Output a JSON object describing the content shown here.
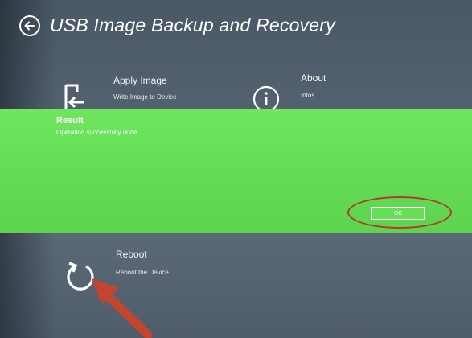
{
  "app": {
    "title": "USB Image Backup and Recovery"
  },
  "tiles": [
    {
      "title": "Apply Image",
      "subtitle": "Write Image to Device",
      "icon": "import-arrow-icon"
    },
    {
      "title": "About",
      "subtitle": "Infos",
      "icon": "info-icon"
    },
    {
      "title": "Reboot",
      "subtitle": "Reboot the Device",
      "icon": "refresh-icon"
    }
  ],
  "dialog": {
    "title": "Result",
    "message": "Operation successfully done.",
    "ok_label": "OK",
    "background_color": "#66de56"
  },
  "colors": {
    "background": "#556372",
    "annotation": "#b23a2c"
  }
}
